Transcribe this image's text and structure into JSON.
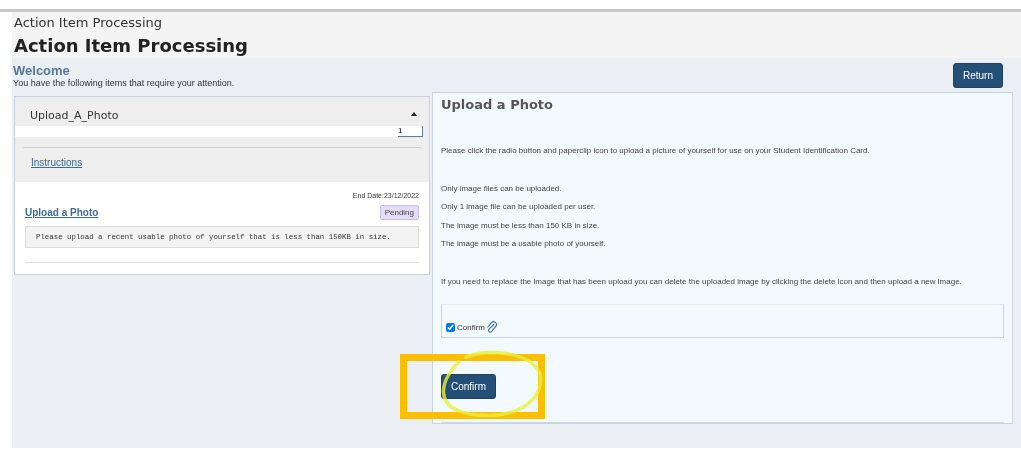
{
  "breadcrumb": "Action Item Processing",
  "title": "Action Item Processing",
  "welcome": {
    "heading": "Welcome",
    "message": "You have the following items that require your attention.",
    "return_button": "Return"
  },
  "group": {
    "name": "Upload_A_Photo",
    "expanded": true,
    "count": "1",
    "instructions_link": "Instructions"
  },
  "item": {
    "end_date": "End Date:23/12/2022",
    "link": "Upload a Photo",
    "status": "Pending",
    "description": "Please upload a recent usable photo of yourself that is less than 150KB in size."
  },
  "detail": {
    "heading": "Upload a Photo",
    "paragraphs": [
      [
        "Please click the radio button and paperclip icon to upload a picture of yourself for use on your Student Identification Card."
      ],
      [
        "Only image files can be uploaded.",
        "Only 1 image file can be uploaded per user.",
        "The image must be less than 150 KB in size.",
        "The image must be a usable photo of yourself."
      ],
      [
        "If you need to replace the image that has been upload you can delete the uploaded image by clicking the delete icon and then upload a new image."
      ]
    ],
    "confirm_checkbox": {
      "label": "Confirm",
      "checked": true
    },
    "confirm_button": "Confirm"
  }
}
